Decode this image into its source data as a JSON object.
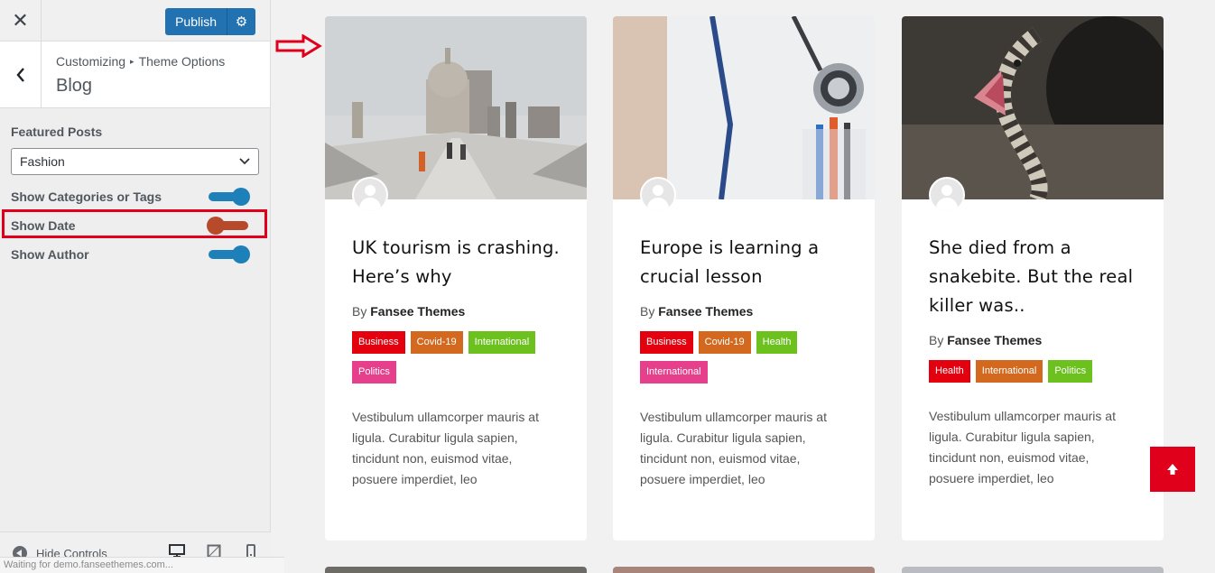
{
  "sidebar": {
    "publish_label": "Publish",
    "breadcrumb_root": "Customizing",
    "breadcrumb_parent": "Theme Options",
    "section_title": "Blog",
    "featured_posts_label": "Featured Posts",
    "featured_posts_value": "Fashion",
    "toggles": [
      {
        "label": "Show Categories or Tags",
        "on": true
      },
      {
        "label": "Show Date",
        "on": false
      },
      {
        "label": "Show Author",
        "on": true
      }
    ],
    "hide_controls_label": "Hide Controls",
    "status_text": "Waiting for demo.fanseethemes.com..."
  },
  "colors": {
    "accent": "#2271b1",
    "toggle_on": "#1e80b8",
    "toggle_off": "#b84a2c",
    "highlight": "#e0001b",
    "scroll_top": "#e0001b"
  },
  "posts": [
    {
      "title": "UK tourism is crashing. Here’s why",
      "by_prefix": "By",
      "author": "Fansee Themes",
      "tags": [
        {
          "label": "Business",
          "color": "#e3000f"
        },
        {
          "label": "Covid-19",
          "color": "#d2691e"
        },
        {
          "label": "International",
          "color": "#6cc11f"
        },
        {
          "label": "Politics",
          "color": "#e6408c"
        }
      ],
      "excerpt": "Vestibulum ullamcorper mauris at ligula. Curabitur ligula sapien, tincidunt non, euismod vitae, posuere imperdiet, leo"
    },
    {
      "title": "Europe is learning a crucial lesson",
      "by_prefix": "By",
      "author": "Fansee Themes",
      "tags": [
        {
          "label": "Business",
          "color": "#e3000f"
        },
        {
          "label": "Covid-19",
          "color": "#d2691e"
        },
        {
          "label": "Health",
          "color": "#6cc11f"
        },
        {
          "label": "International",
          "color": "#e6408c"
        }
      ],
      "excerpt": "Vestibulum ullamcorper mauris at ligula. Curabitur ligula sapien, tincidunt non, euismod vitae, posuere imperdiet, leo"
    },
    {
      "title": "She died from a snakebite. But the real killer was..",
      "by_prefix": "By",
      "author": "Fansee Themes",
      "tags": [
        {
          "label": "Health",
          "color": "#e3000f"
        },
        {
          "label": "International",
          "color": "#d2691e"
        },
        {
          "label": "Politics",
          "color": "#6cc11f"
        }
      ],
      "excerpt": "Vestibulum ullamcorper mauris at ligula. Curabitur ligula sapien, tincidunt non, euismod vitae, posuere imperdiet, leo"
    }
  ]
}
